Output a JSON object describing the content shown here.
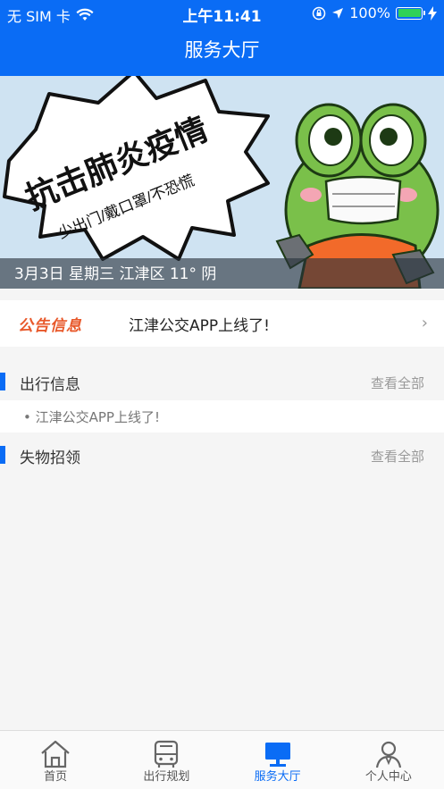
{
  "status_bar": {
    "carrier": "无 SIM 卡",
    "time": "上午11:41",
    "battery_percent": "100%",
    "battery_level": 1.0
  },
  "nav": {
    "title": "服务大厅"
  },
  "banner": {
    "headline": "抗击肺炎疫情",
    "slogan": "少出门/戴口罩/不恐慌",
    "caption": "3月3日 星期三 江津区 11° 阴"
  },
  "notice": {
    "tag": "公告信息",
    "text": "江津公交APP上线了!",
    "chevron": "›"
  },
  "travel_info": {
    "title": "出行信息",
    "more": "查看全部",
    "items": [
      "• 江津公交APP上线了!"
    ]
  },
  "lost_found": {
    "title": "失物招领",
    "more": "查看全部"
  },
  "tabbar": {
    "tabs": [
      {
        "label": "首页",
        "icon": "home-icon"
      },
      {
        "label": "出行规划",
        "icon": "bus-icon"
      },
      {
        "label": "服务大厅",
        "icon": "monitor-icon",
        "active": true
      },
      {
        "label": "个人中心",
        "icon": "user-icon"
      }
    ]
  },
  "colors": {
    "primary": "#0a6cf5",
    "notice_tag": "#e8582a",
    "battery": "#2fd158"
  }
}
